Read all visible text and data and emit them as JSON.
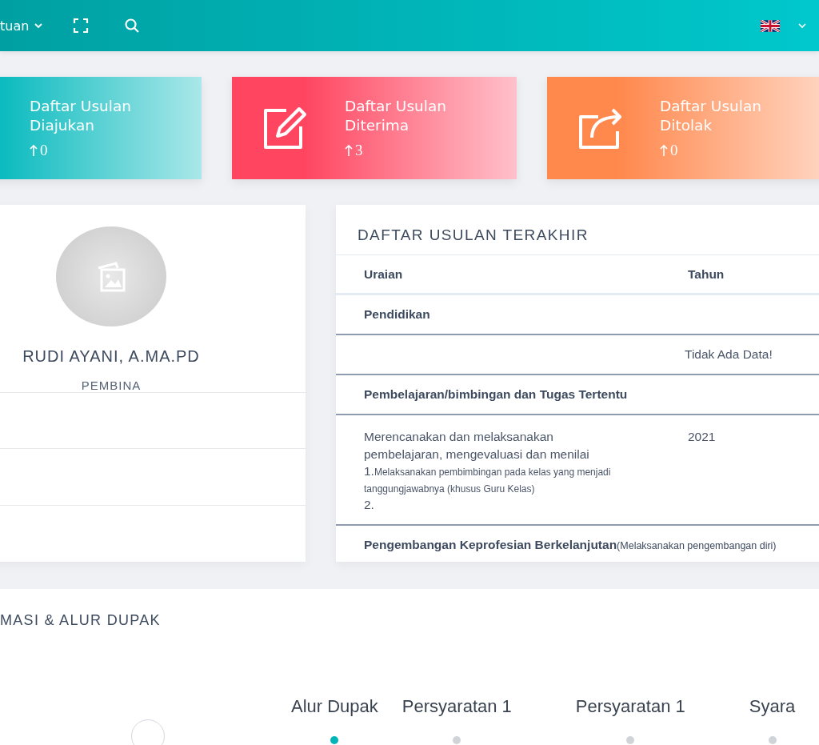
{
  "header": {
    "menu_label": "tuan"
  },
  "cards": [
    {
      "kind": "none",
      "title": "Daftar Usulan Diajukan",
      "count": "0",
      "color": "#00b8bc"
    },
    {
      "kind": "edit",
      "title": "Daftar Usulan Diterima",
      "count": "3",
      "color": "#ff4560"
    },
    {
      "kind": "share",
      "title": "Daftar Usulan Ditolak",
      "count": "0",
      "color": "#ff884d"
    }
  ],
  "profile": {
    "name": "RUDI AYANI, A.MA.PD",
    "rank": "PEMBINA"
  },
  "table": {
    "title": "DAFTAR USULAN TERAKHIR",
    "columns": [
      "Uraian",
      "Tahun"
    ],
    "rows": [
      {
        "kind": "group",
        "text": "Pendidikan"
      },
      {
        "kind": "empty",
        "text": "Tidak Ada Data!"
      },
      {
        "kind": "group",
        "text": "Pembelajaran/bimbingan dan Tugas Tertentu"
      },
      {
        "kind": "item",
        "text": "Merencanakan dan melaksanakan pembelajaran, mengevaluasi dan menilai",
        "year": "2021",
        "steps": [
          {
            "number": "1.",
            "text": "Melaksanakan pembimbingan pada kelas yang menjadi tanggungjawabnya (khusus Guru Kelas)"
          },
          {
            "number": "2."
          }
        ]
      },
      {
        "kind": "group",
        "text": "Pengembangan Keprofesian Berkelanjutan",
        "note": "(Melaksanakan pengembangan diri)"
      }
    ]
  },
  "info": {
    "title": "MASI & ALUR DUPAK",
    "tabs": [
      {
        "label": "Alur Dupak",
        "selected": true
      },
      {
        "label": "Persyaratan 1",
        "selected": false
      },
      {
        "label": "Persyaratan 1",
        "selected": false
      },
      {
        "label": "Syara",
        "selected": false
      }
    ]
  }
}
